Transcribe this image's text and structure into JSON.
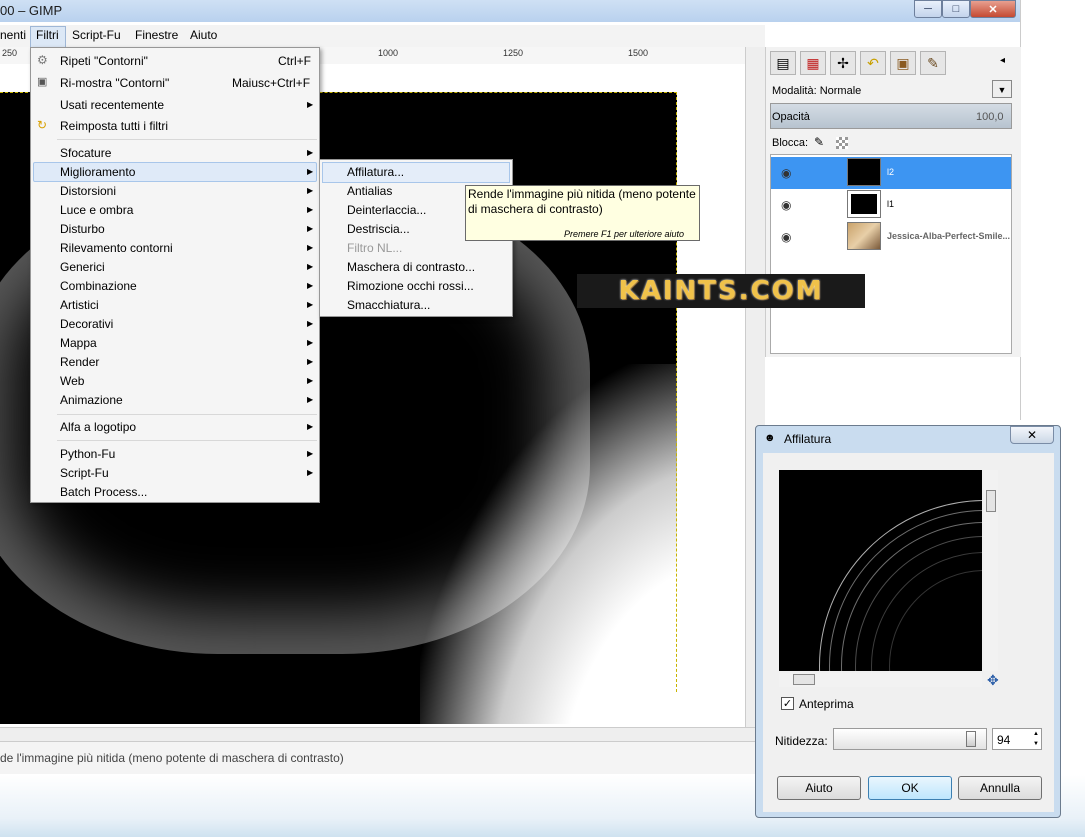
{
  "window": {
    "title": "00 – GIMP",
    "min": "─",
    "max": "□",
    "close": "✕"
  },
  "menubar": {
    "items": [
      "nenti",
      "Filtri",
      "Script-Fu",
      "Finestre",
      "Aiuto"
    ]
  },
  "ruler": {
    "labels": [
      "250",
      "1000",
      "1250",
      "1500"
    ]
  },
  "filters_menu": {
    "repeat": {
      "label": "Ripeti \"Contorni\"",
      "shortcut": "Ctrl+F"
    },
    "reshow": {
      "label": "Ri-mostra \"Contorni\"",
      "shortcut": "Maiusc+Ctrl+F"
    },
    "recent": "Usati recentemente",
    "reset": "Reimposta tutti i filtri",
    "groups": [
      "Sfocature",
      "Miglioramento",
      "Distorsioni",
      "Luce e ombra",
      "Disturbo",
      "Rilevamento contorni",
      "Generici",
      "Combinazione",
      "Artistici",
      "Decorativi",
      "Mappa",
      "Render",
      "Web",
      "Animazione"
    ],
    "alpha_logo": "Alfa a logotipo",
    "python_fu": "Python-Fu",
    "script_fu": "Script-Fu",
    "batch": "Batch Process..."
  },
  "enhance_submenu": {
    "items": [
      "Affilatura...",
      "Antialias",
      "Deinterlaccia...",
      "Destriscia...",
      "Filtro NL...",
      "Maschera di contrasto...",
      "Rimozione occhi rossi...",
      "Smacchiatura..."
    ]
  },
  "tooltip": {
    "text": "Rende l'immagine più nitida (meno potente di maschera di contrasto)",
    "hint": "Premere F1 per ulteriore aiuto"
  },
  "watermark": {
    "text": "KAINTS.COM"
  },
  "status": {
    "text": "de l'immagine più nitida (meno potente di maschera di contrasto)"
  },
  "layers_panel": {
    "mode_label": "Modalità: Normale",
    "opacity_label": "Opacità",
    "opacity_value": "100,0",
    "lock_label": "Blocca:",
    "layers": [
      {
        "name": "l2",
        "selected": true
      },
      {
        "name": "l1",
        "selected": false
      },
      {
        "name": "Jessica-Alba-Perfect-Smile...",
        "selected": false
      }
    ]
  },
  "sharpen_dialog": {
    "title": "Affilatura",
    "close": "✕",
    "preview_label": "Anteprima",
    "preview_checked": true,
    "sharpness_label": "Nitidezza:",
    "sharpness_value": "94",
    "sharpness_fraction": 0.94,
    "buttons": {
      "help": "Aiuto",
      "ok": "OK",
      "cancel": "Annulla"
    }
  },
  "colors": {
    "selection": "#dfeaf8",
    "tooltip_bg": "#ffffe1",
    "layer_selected": "#3d95f2"
  }
}
